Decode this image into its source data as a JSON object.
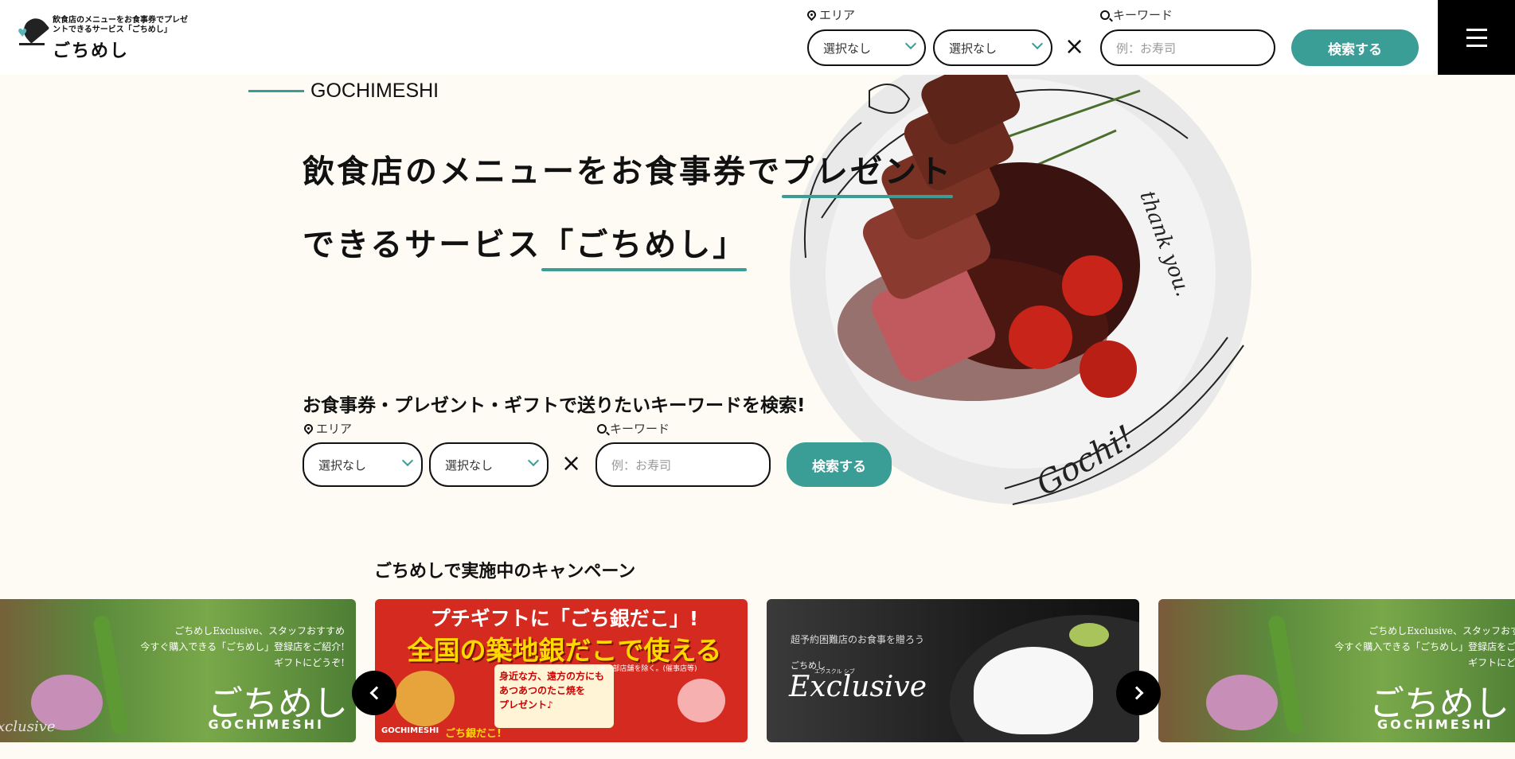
{
  "header": {
    "logo_tagline": "飲食店のメニューをお食事券でプレゼントできるサービス「ごちめし」",
    "logo_name": "ごちめし",
    "area_label": "エリア",
    "keyword_label": "キーワード",
    "area_select_1": "選択なし",
    "area_select_2": "選択なし",
    "clear": "×",
    "keyword_placeholder": "例：お寿司",
    "search_button": "検索する"
  },
  "hero": {
    "eyebrow": "GOCHIMESHI",
    "title_line1_a": "飲食店のメニューをお食事券で",
    "title_line1_b": "プレゼント",
    "title_line2_a": "できるサービス",
    "title_line2_b": "「ごちめし」",
    "plate_text_top": "thank you.",
    "plate_text_bottom": "Gochi!"
  },
  "search": {
    "heading": "お食事券・プレゼント・ギフトで送りたいキーワードを検索!",
    "area_label": "エリア",
    "keyword_label": "キーワード",
    "area_select_1": "選択なし",
    "area_select_2": "選択なし",
    "clear": "×",
    "keyword_placeholder": "例：お寿司",
    "search_button": "検索する"
  },
  "campaigns": {
    "title": "ごちめしで実施中のキャンペーン",
    "cards": [
      {
        "line1": "ごちめしExclusive、スタッフおすすめ",
        "line2": "今すぐ購入できる「ごちめし」登録店をご紹介!",
        "line3": "ギフトにどうぞ!",
        "brand": "ごちめし",
        "brand_en": "GOCHIMESHI",
        "script": "Exclusive"
      },
      {
        "headline1": "プチギフトに「ごち銀だこ」!",
        "headline2": "全国の築地銀だこで使える",
        "sub1": "身近な方、遠方の方にも",
        "sub2": "あつあつのたこ焼を",
        "sub3": "プレゼント♪",
        "note": "※一部店舗を除く。(催事店等)",
        "logo": "GOCHIMESHI",
        "badge": "ごち銀だこ!"
      },
      {
        "line1": "超予約困難店のお食事を贈ろう",
        "brand": "ごちめし",
        "script": "Exclusive",
        "ruby": "エクスクル シブ"
      },
      {
        "line1": "ごちめしExclusive、スタッフおすすめ",
        "line2": "今すぐ購入できる「ごちめし」登録店をご紹介!",
        "line3": "ギフトにどうぞ!",
        "brand": "ごちめし",
        "brand_en": "GOCHIMESHI"
      }
    ]
  },
  "colors": {
    "accent": "#3a9e97",
    "background": "#fdfbf3",
    "dark": "#000000"
  },
  "icons": [
    "location-pin-icon",
    "search-icon",
    "chevron-down-icon",
    "close-icon",
    "hamburger-menu-icon",
    "arrow-left-icon",
    "arrow-right-icon"
  ]
}
